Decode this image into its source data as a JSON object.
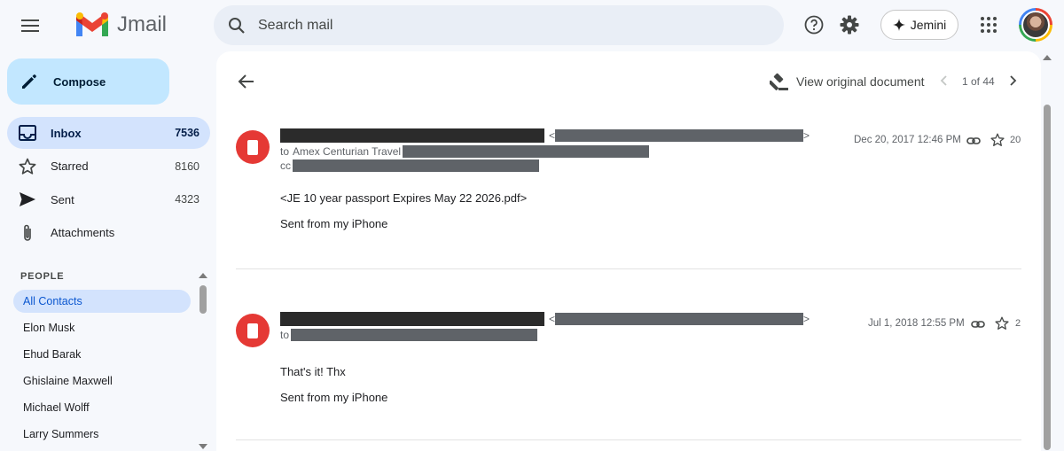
{
  "header": {
    "app_name": "Jmail",
    "search_placeholder": "Search mail",
    "jemini_label": "Jemini"
  },
  "sidebar": {
    "compose_label": "Compose",
    "items": [
      {
        "label": "Inbox",
        "count": "7536",
        "icon": "inbox-icon",
        "active": true
      },
      {
        "label": "Starred",
        "count": "8160",
        "icon": "star-icon",
        "active": false
      },
      {
        "label": "Sent",
        "count": "4323",
        "icon": "send-icon",
        "active": false
      },
      {
        "label": "Attachments",
        "count": "",
        "icon": "paperclip-icon",
        "active": false
      }
    ],
    "people_header": "PEOPLE",
    "people": [
      {
        "name": "All Contacts",
        "active": true
      },
      {
        "name": "Elon Musk"
      },
      {
        "name": "Ehud Barak"
      },
      {
        "name": "Ghislaine Maxwell"
      },
      {
        "name": "Michael Wolff"
      },
      {
        "name": "Larry Summers"
      }
    ]
  },
  "toolbar": {
    "view_original_label": "View original document",
    "pager_text": "1 of 44"
  },
  "messages": [
    {
      "sender_redacted": true,
      "to_prefix": "to",
      "to_name": "Amex Centurian Travel",
      "cc_label": "cc",
      "date": "Dec 20, 2017 12:46 PM",
      "star_count": "20",
      "body_lines": [
        "<JE 10 year passport Expires May 22 2026.pdf>",
        "Sent from my iPhone"
      ]
    },
    {
      "sender_redacted": true,
      "to_prefix": "to",
      "to_name": "",
      "date": "Jul 1, 2018 12:55 PM",
      "star_count": "2",
      "body_lines": [
        "That's it! Thx",
        "Sent from my iPhone"
      ]
    }
  ],
  "colors": {
    "compose_bg": "#c2e7ff",
    "active_nav_bg": "#d3e3fd",
    "search_bg": "#e9eef6",
    "pdf_red": "#e53935",
    "redaction": "#2b2b2b"
  }
}
